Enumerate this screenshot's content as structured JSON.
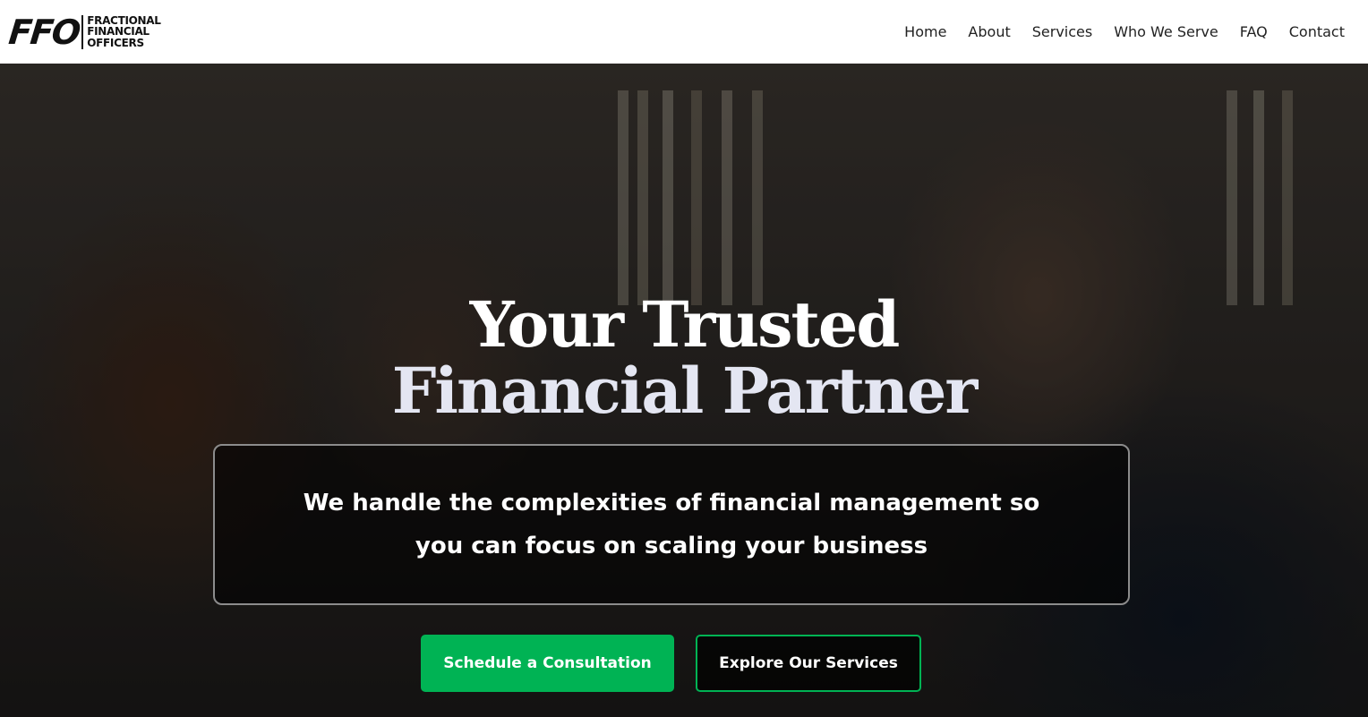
{
  "brand": {
    "mark": "FFO",
    "words": [
      "FRACTIONAL",
      "FINANCIAL",
      "OFFICERS"
    ]
  },
  "nav": {
    "items": [
      "Home",
      "About",
      "Services",
      "Who We Serve",
      "FAQ",
      "Contact"
    ]
  },
  "hero": {
    "title_line1": "Your Trusted",
    "title_line2": "Financial Partner",
    "tagline": "We handle the complexities of financial management so you can focus on scaling your business",
    "primary_cta": "Schedule a Consultation",
    "secondary_cta": "Explore Our Services"
  },
  "colors": {
    "accent": "#00b354",
    "header_bg": "#ffffff",
    "title_secondary": "#e4e6f2"
  }
}
